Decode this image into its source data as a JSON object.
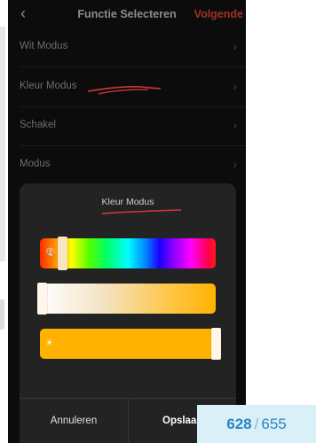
{
  "header": {
    "back_icon": "chevron-left-icon",
    "title": "Functie Selecteren",
    "next_label": "Volgende",
    "next_color": "#a0322a"
  },
  "menu": {
    "items": [
      {
        "label": "Wit Modus"
      },
      {
        "label": "Kleur Modus"
      },
      {
        "label": "Schakel"
      },
      {
        "label": "Modus"
      }
    ]
  },
  "sheet": {
    "title": "Kleur Modus",
    "sliders": [
      {
        "name": "hue",
        "icon": "palette-icon",
        "level": 0.1
      },
      {
        "name": "saturation",
        "icon": "drop-icon",
        "level": 0.0
      },
      {
        "name": "brightness",
        "icon": "sun-icon",
        "level": 1.0
      }
    ],
    "cancel_label": "Annuleren",
    "save_label": "Opslaan"
  },
  "annotation_color": "#d23a36",
  "counter": {
    "current": "628",
    "separator": "/",
    "total": "655"
  }
}
